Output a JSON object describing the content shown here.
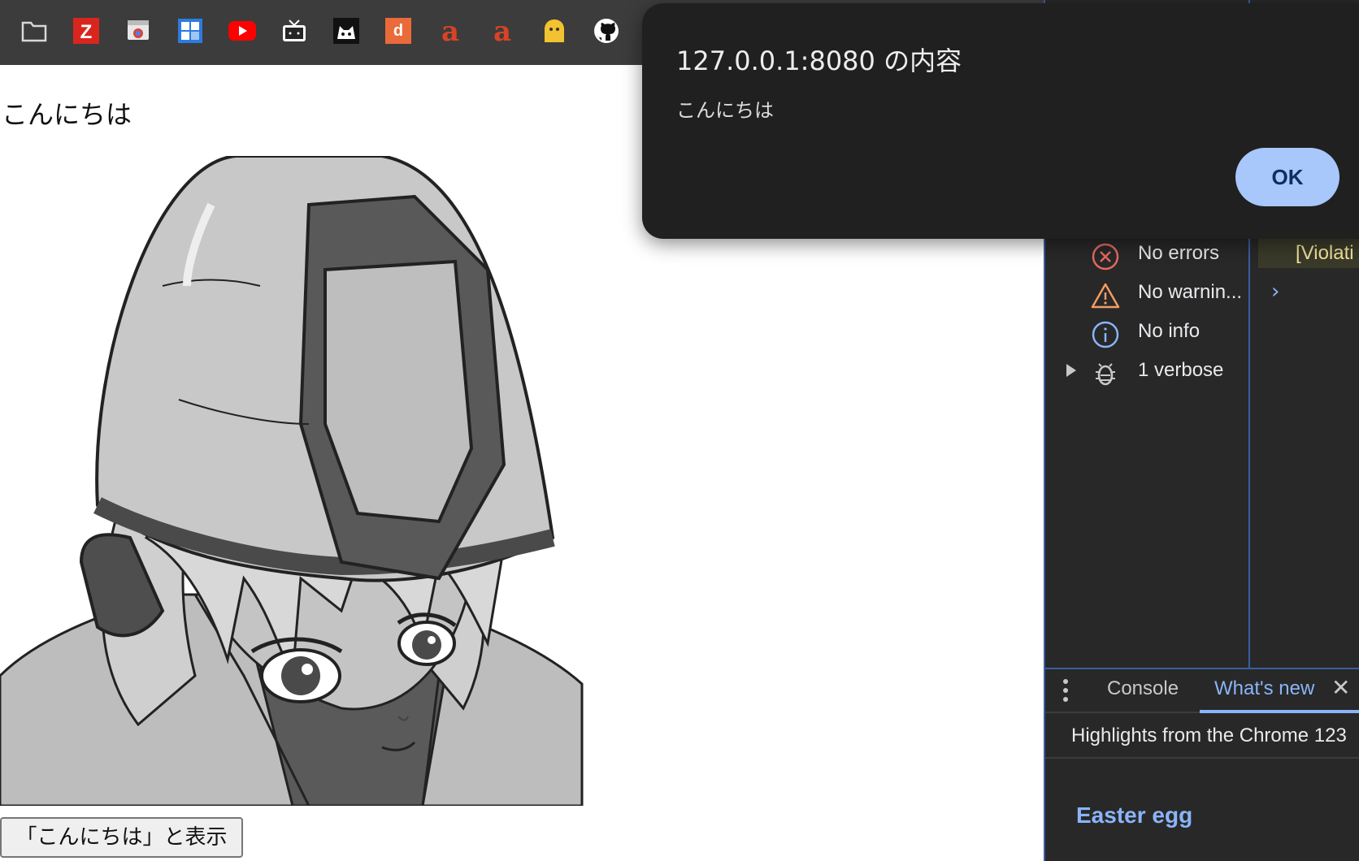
{
  "bookmarks": {
    "items": [
      {
        "icon": "folder-icon"
      },
      {
        "icon": "z-icon",
        "label": "Z"
      },
      {
        "icon": "chrome-web-store-icon"
      },
      {
        "icon": "grid-app-icon"
      },
      {
        "icon": "youtube-icon"
      },
      {
        "icon": "niconico-icon"
      },
      {
        "icon": "cat-site-icon"
      },
      {
        "icon": "d-anime-store-icon",
        "label": "d"
      },
      {
        "icon": "amazon-icon",
        "label": "a"
      },
      {
        "icon": "amazon-icon",
        "label": "a"
      },
      {
        "icon": "yellow-ghost-icon"
      },
      {
        "icon": "github-icon"
      }
    ]
  },
  "page": {
    "heading_text": "こんにちは",
    "illustration": "anime-girl-with-hardhat",
    "button_label": "「こんにちは」と表示"
  },
  "dialog": {
    "title": "127.0.0.1:8080 の内容",
    "message": "こんにちは",
    "ok_label": "OK"
  },
  "devtools": {
    "filters": [
      {
        "label": "No errors",
        "icon": "error-icon",
        "color": "#e46962"
      },
      {
        "label": "No warnin...",
        "icon": "warning-icon",
        "color": "#f29c62"
      },
      {
        "label": "No info",
        "icon": "info-icon",
        "color": "#8ab4f8"
      },
      {
        "label": "1 verbose",
        "icon": "bug-icon",
        "color": "#c8c8c8"
      }
    ],
    "violation_text": "[Violati",
    "tabs": {
      "console": "Console",
      "whats_new": "What's new"
    },
    "highlights_text": "Highlights from the Chrome 123",
    "easter_egg": "Easter egg"
  },
  "colors": {
    "accent": "#8ab4f8",
    "dialog_bg": "#202020",
    "ok_button_bg": "#a8c7fa",
    "bookmarks_bg": "#3c3c3c"
  }
}
